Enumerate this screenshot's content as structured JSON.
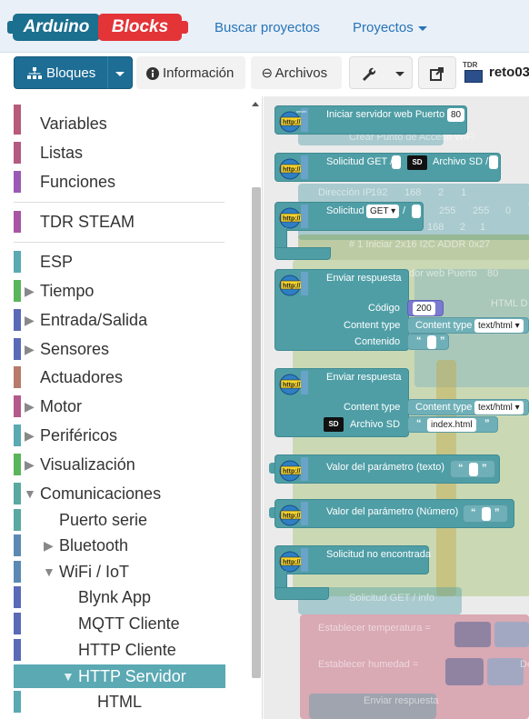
{
  "navbar": {
    "logo_left": "Arduino",
    "logo_right": "Blocks",
    "links": [
      "Buscar proyectos",
      "Proyectos"
    ]
  },
  "toolbar": {
    "blocks_label": "Bloques",
    "info_label": "Información",
    "files_label": "Archivos",
    "project_name": "reto03",
    "board_tag": "TDR"
  },
  "sidebar": {
    "items": [
      {
        "label": "Variables",
        "color": "#b85a7c"
      },
      {
        "label": "Listas",
        "color": "#b45a82"
      },
      {
        "label": "Funciones",
        "color": "#9b59b6"
      },
      {
        "label": "TDR STEAM",
        "color": "#a855a5"
      },
      {
        "label": "ESP",
        "color": "#5aa9b3"
      },
      {
        "label": "Tiempo",
        "color": "#5bb55b"
      },
      {
        "label": "Entrada/Salida",
        "color": "#5a6ab8"
      },
      {
        "label": "Sensores",
        "color": "#5a6ab8"
      },
      {
        "label": "Actuadores",
        "color": "#b87a6a"
      },
      {
        "label": "Motor",
        "color": "#b45a8a"
      },
      {
        "label": "Periféricos",
        "color": "#5aa9b3"
      },
      {
        "label": "Visualización",
        "color": "#5bb55b"
      },
      {
        "label": "Comunicaciones",
        "color": "#5aa9a0"
      },
      {
        "label": "Puerto serie",
        "color": "#5aa9a0"
      },
      {
        "label": "Bluetooth",
        "color": "#5a8ab3"
      },
      {
        "label": "WiFi / IoT",
        "color": "#5a8ab3"
      },
      {
        "label": "Blynk App",
        "color": "#5a6ab8"
      },
      {
        "label": "MQTT Cliente",
        "color": "#5a6ab8"
      },
      {
        "label": "HTTP Cliente",
        "color": "#5a6ab8"
      },
      {
        "label": "HTTP Servidor",
        "color": "#5aa9b3"
      },
      {
        "label": "HTML",
        "color": "#5aa9b3"
      }
    ]
  },
  "blocks": {
    "b1": {
      "label": "Iniciar servidor web  Puerto",
      "port": "80"
    },
    "b2": {
      "label": "Solicitud GET /",
      "file_label": "Archivo SD /"
    },
    "b3": {
      "label": "Solicitud",
      "method": "GET",
      "slash": "/"
    },
    "b4": {
      "title": "Enviar respuesta",
      "code_label": "Código",
      "code": "200",
      "ctype_label": "Content type",
      "ctype_inner": "Content type",
      "ctype_value": "text/html",
      "content_label": "Contenido"
    },
    "b5": {
      "title": "Enviar respuesta",
      "ctype_label": "Content type",
      "ctype_inner": "Content type",
      "ctype_value": "text/html",
      "file_label": "Archivo SD",
      "file_value": "index.html"
    },
    "b6": {
      "label": "Valor del parámetro (texto)"
    },
    "b7": {
      "label": "Valor del parámetro (Número)"
    },
    "b8": {
      "label": "Solicitud no encontrada"
    },
    "quote_open": "“",
    "quote_close": "”"
  },
  "ghost_text": {
    "wifi": "Crear Punto de Acceso WiFi",
    "ip": "Dirección IP",
    "ip_vals": [
      "192",
      "168",
      "2",
      "1"
    ],
    "mask_vals": [
      "255",
      "255",
      "0"
    ],
    "gw_vals": [
      "168",
      "2",
      "1"
    ],
    "lcd": "# 1  Iniciar  2x16  I2C ADDR 0x27",
    "server": "dor web  Puerto",
    "server_port": "80",
    "html": "HTML D",
    "req": "Solicitud  GET  /  info",
    "temp": "Establecer  temperatura  =",
    "hum": "Establecer  humedad  =",
    "send": "Enviar respuesta",
    "de": "De"
  }
}
